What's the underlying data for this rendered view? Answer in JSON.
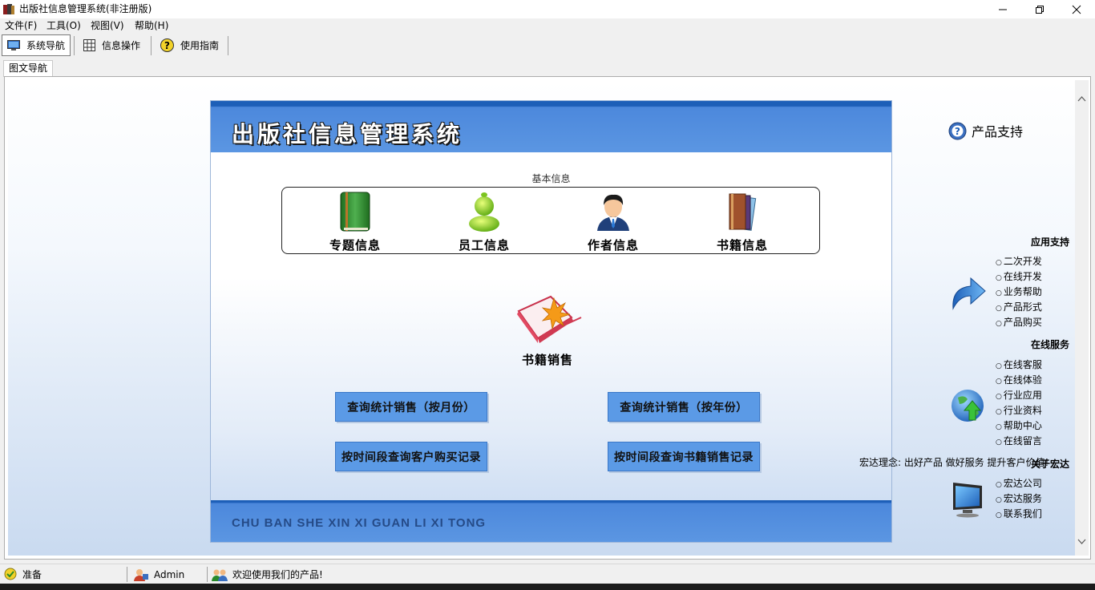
{
  "window": {
    "title": "出版社信息管理系统(非注册版)"
  },
  "menu": [
    "文件(F)",
    "工具(O)",
    "视图(V)",
    "帮助(H)"
  ],
  "toolbar": {
    "nav": "系统导航",
    "ops": "信息操作",
    "guide": "使用指南"
  },
  "tab": {
    "label": "图文导航"
  },
  "panel": {
    "title": "出版社信息管理系统",
    "section_basic": "基本信息",
    "basic_items": [
      "专题信息",
      "员工信息",
      "作者信息",
      "书籍信息"
    ],
    "sales_label": "书籍销售",
    "buttons": [
      "查询统计销售（按月份）",
      "查询统计销售（按年份）",
      "按时间段查询客户购买记录",
      "按时间段查询书籍销售记录"
    ],
    "footer": "CHU BAN SHE XIN XI GUAN LI XI TONG"
  },
  "side": {
    "heading": "产品支持",
    "groups": [
      {
        "title": "应用支持",
        "links": [
          "二次开发",
          "在线开发",
          "业务帮助",
          "产品形式",
          "产品购买"
        ]
      },
      {
        "title": "在线服务",
        "links": [
          "在线客服",
          "在线体验",
          "行业应用",
          "行业资料",
          "帮助中心",
          "在线留言"
        ]
      },
      {
        "title": "关于宏达",
        "links": [
          "宏达公司",
          "宏达服务",
          "联系我们"
        ]
      }
    ],
    "slogan": "宏达理念: 出好产品  做好服务  提升客户价值!"
  },
  "status": {
    "state": "准备",
    "user": "Admin",
    "message": "欢迎使用我们的产品!"
  },
  "colors": {
    "header_blue": "#5b96e2",
    "button_blue": "#5b9ae6",
    "dark_blue": "#1d5fb8"
  }
}
